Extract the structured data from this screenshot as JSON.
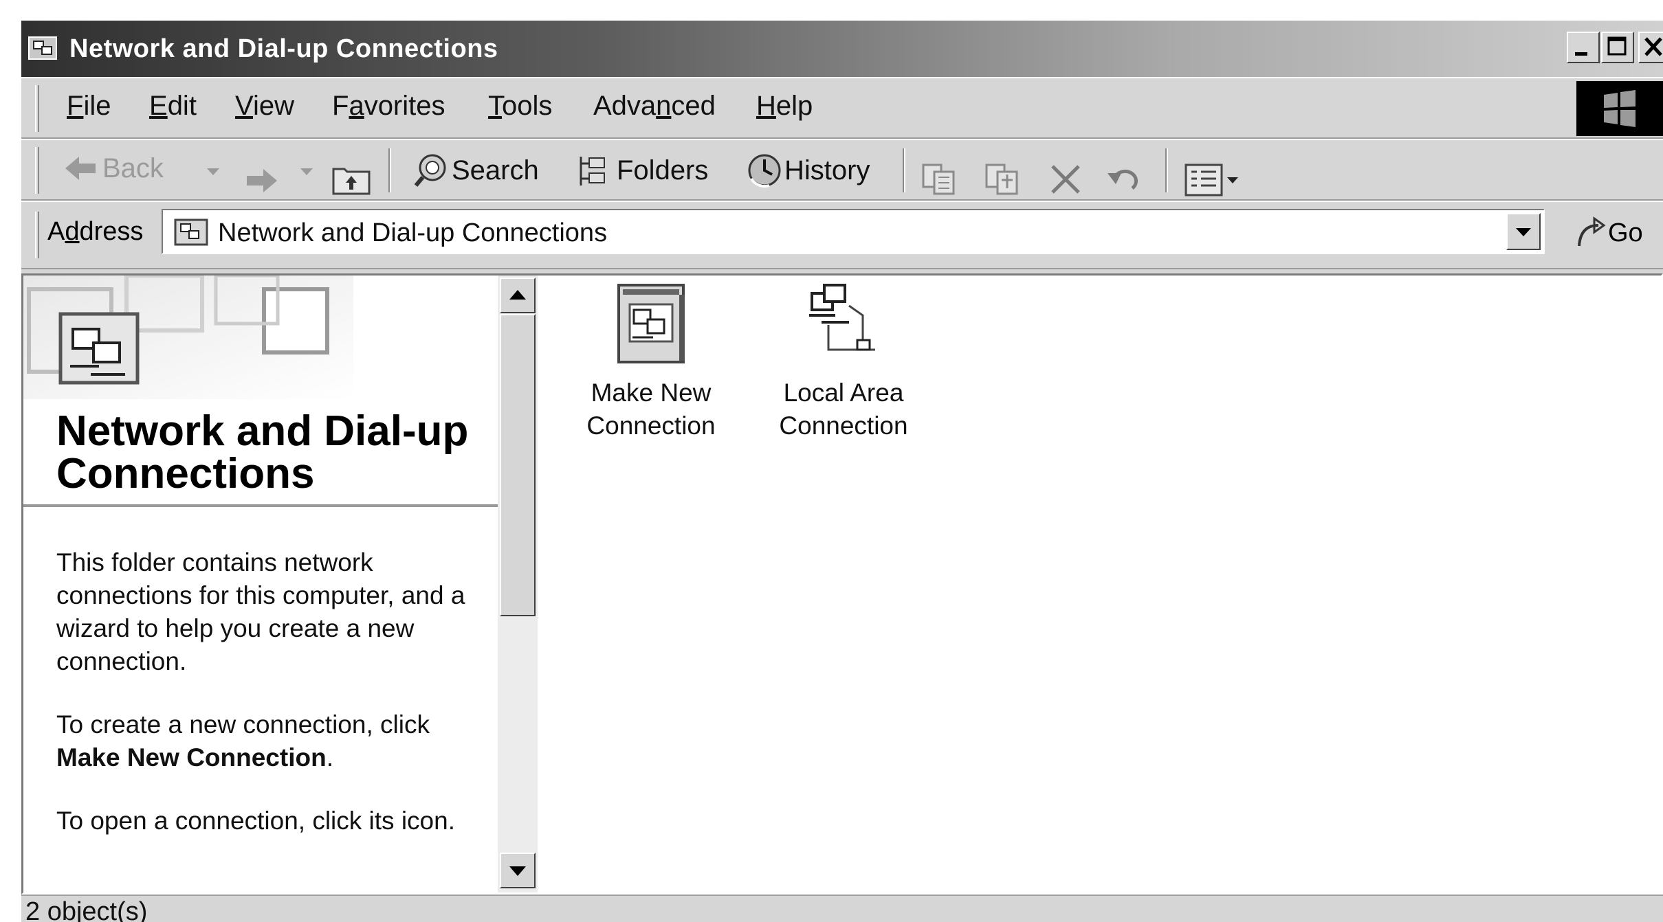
{
  "window": {
    "title": "Network and Dial-up Connections",
    "minimize_label": "_",
    "maximize_label": "□",
    "close_label": "×"
  },
  "menu": {
    "items": [
      {
        "label": "File",
        "underline": "F"
      },
      {
        "label": "Edit",
        "underline": "E"
      },
      {
        "label": "View",
        "underline": "V"
      },
      {
        "label": "Favorites",
        "underline": "a"
      },
      {
        "label": "Tools",
        "underline": "T"
      },
      {
        "label": "Advanced",
        "underline": "n"
      },
      {
        "label": "Help",
        "underline": "H"
      }
    ]
  },
  "toolbar": {
    "back_label": "Back",
    "search_label": "Search",
    "folders_label": "Folders",
    "history_label": "History"
  },
  "address": {
    "label": "Address",
    "value": "Network and Dial-up Connections",
    "go_label": "Go"
  },
  "left_pane": {
    "title": "Network and Dial-up Connections",
    "paragraph1": "This folder contains network connections for this computer, and a wizard to help you create a new connection.",
    "paragraph2_prefix": "To create a new connection, click",
    "paragraph2_bold": "Make New Connection",
    "paragraph2_suffix": ".",
    "paragraph3": "To open a connection, click its icon."
  },
  "items": [
    {
      "line1": "Make New",
      "line2": "Connection",
      "icon": "make-new-connection-icon"
    },
    {
      "line1": "Local Area",
      "line2": "Connection",
      "icon": "local-area-connection-icon"
    }
  ],
  "status": {
    "text": "2 object(s)"
  }
}
